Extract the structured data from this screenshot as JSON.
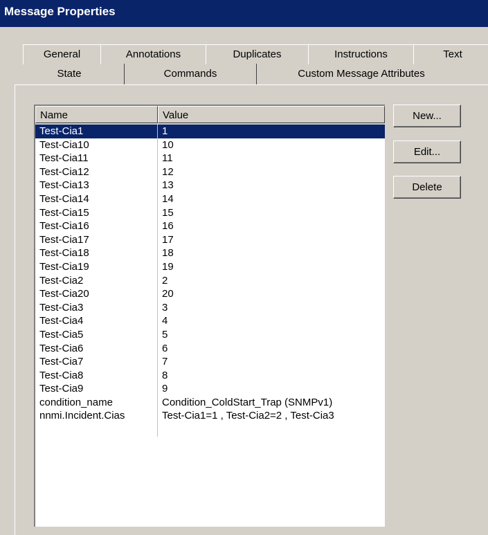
{
  "window": {
    "title": "Message Properties"
  },
  "tabs_row1": [
    "General",
    "Annotations",
    "Duplicates",
    "Instructions",
    "Text"
  ],
  "tabs_row2": [
    "State",
    "Commands",
    "Custom Message Attributes"
  ],
  "active_tab": "Custom Message Attributes",
  "table": {
    "headers": [
      "Name",
      "Value"
    ],
    "selected_row": 0,
    "rows": [
      [
        "Test-Cia1",
        "1"
      ],
      [
        "Test-Cia10",
        "10"
      ],
      [
        "Test-Cia11",
        "11"
      ],
      [
        "Test-Cia12",
        "12"
      ],
      [
        "Test-Cia13",
        "13"
      ],
      [
        "Test-Cia14",
        "14"
      ],
      [
        "Test-Cia15",
        "15"
      ],
      [
        "Test-Cia16",
        "16"
      ],
      [
        "Test-Cia17",
        "17"
      ],
      [
        "Test-Cia18",
        "18"
      ],
      [
        "Test-Cia19",
        "19"
      ],
      [
        "Test-Cia2",
        "2"
      ],
      [
        "Test-Cia20",
        "20"
      ],
      [
        "Test-Cia3",
        "3"
      ],
      [
        "Test-Cia4",
        "4"
      ],
      [
        "Test-Cia5",
        "5"
      ],
      [
        "Test-Cia6",
        "6"
      ],
      [
        "Test-Cia7",
        "7"
      ],
      [
        "Test-Cia8",
        "8"
      ],
      [
        "Test-Cia9",
        "9"
      ],
      [
        "condition_name",
        "Condition_ColdStart_Trap (SNMPv1)"
      ],
      [
        "nnmi.Incident.Cias",
        "Test-Cia1=1 , Test-Cia2=2 , Test-Cia3"
      ],
      [
        "",
        ""
      ]
    ]
  },
  "buttons": {
    "new": "New...",
    "edit": "Edit...",
    "delete": "Delete"
  }
}
